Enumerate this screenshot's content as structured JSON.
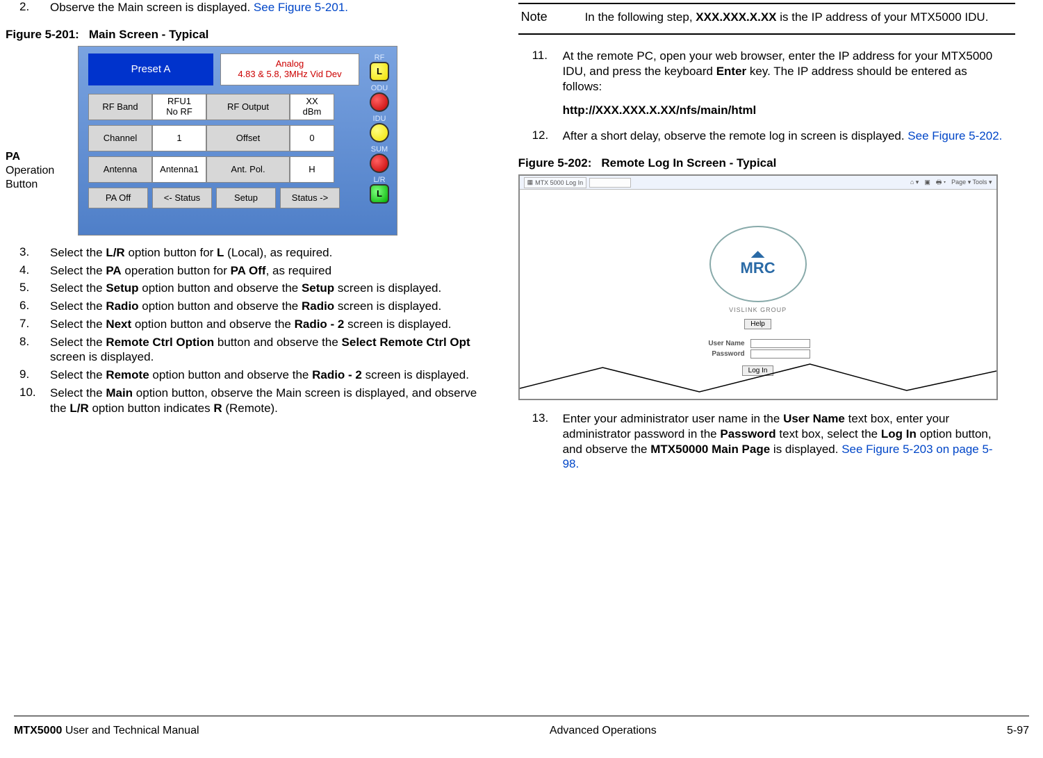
{
  "steps_left": {
    "s2_a": "Observe the Main screen is displayed.  ",
    "s2_xref": "See Figure 5-201",
    "s3": "Select the L/R option button for L (Local), as required.",
    "s4": "Select the PA operation button for PA Off, as required",
    "s5": "Select the Setup option button and observe the Setup screen is displayed.",
    "s6": "Select the Radio option button and observe the Radio screen is displayed.",
    "s7": "Select the Next option button and observe the Radio - 2 screen is displayed.",
    "s8": "Select the Remote Ctrl Option button and observe the Select Remote Ctrl Opt screen is displayed.",
    "s9": "Select the Remote option button and observe the Radio - 2 screen is displayed.",
    "s10": "Select the Main option button, observe the Main screen is displayed, and observe the L/R option button indicates R (Remote)."
  },
  "steps_right": {
    "s11": "At the remote PC, open your web browser, enter the IP address for your MTX5000 IDU, and press the keyboard Enter key.  The IP address should be entered as follows:",
    "url": "http://XXX.XXX.X.XX/nfs/main/html",
    "s12_a": "After a short delay, observe the remote log in screen is displayed.  ",
    "s12_xref": "See Figure 5-202",
    "s13_a": "Enter your administrator user name in the User Name text box, enter your administrator password in the Password text box, select the Log In option button, and observe the MTX50000 Main Page is displayed.  ",
    "s13_xref": "See Figure 5-203 on page 5-98"
  },
  "note": {
    "label": "Note",
    "body": "In the following step, XXX.XXX.X.XX is the IP address of your MTX5000 IDU."
  },
  "fig201": {
    "num": "Figure 5-201:",
    "title": "Main Screen - Typical",
    "callout": "PA Operation Button"
  },
  "fig202": {
    "num": "Figure 5-202:",
    "title": "Remote Log In Screen - Typical"
  },
  "screen": {
    "preset": "Preset A",
    "mode_l1": "Analog",
    "mode_l2": "4.83 & 5.8, 3MHz Vid Dev",
    "rfband_lbl": "RF Band",
    "rfband_v1": "RFU1",
    "rfband_v2": "No RF",
    "rfout_lbl": "RF Output",
    "rfout_v1": "XX",
    "rfout_v2": "dBm",
    "chan_lbl": "Channel",
    "chan_v": "1",
    "off_lbl": "Offset",
    "off_v": "0",
    "ant_lbl": "Antenna",
    "ant_v": "Antenna1",
    "pol_lbl": "Ant. Pol.",
    "pol_v": "H",
    "pa": "PA Off",
    "back": "<- Status",
    "setup": "Setup",
    "fwd": "Status ->",
    "leds": {
      "rf": "RF",
      "odu": "ODU",
      "idu": "IDU",
      "sum": "SUM",
      "lr": "L/R",
      "rf_txt": "L",
      "lr_txt": "L"
    }
  },
  "login": {
    "tab": "MTX 5000 Log In",
    "toolbar": "Page ▾   Tools ▾",
    "logo": "MRC",
    "sub": "VISLINK GROUP",
    "help": "Help",
    "user_lbl": "User Name",
    "pass_lbl": "Password",
    "login_btn": "Log In"
  },
  "footer": {
    "left_bold": "MTX5000",
    "left_rest": " User and Technical Manual",
    "center": "Advanced Operations",
    "right": "5-97"
  }
}
